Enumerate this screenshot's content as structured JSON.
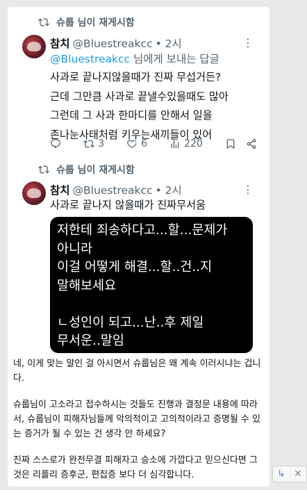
{
  "tweet1": {
    "retweet_text": "슈룹 님이 재게시함",
    "author_name": "참치",
    "author_handle": "@Bluestreakcc",
    "time": "• 2시",
    "reply_mention": "@Bluestreakcc",
    "reply_suffix": " 님에게 보내는 답글",
    "body": "사과로 끝나지않을때가 진짜 무섭거든?\n근데 그만큼 사과로 끝낼수있을때도 많아\n그런데 그 사과 한마디를 안해서 일을\n존나눈사태처럼 키우는새끼들이 있어",
    "retweets": "3",
    "likes": "6",
    "views": "220"
  },
  "tweet2": {
    "retweet_text": "슈룹 님이 재게시함",
    "author_name": "참치",
    "author_handle": "@Bluestreakcc",
    "time": "• 2시",
    "body": "사과로 끝나지 않을때가 진짜무서움",
    "image_text": "저한테 죄송하다고...할...문제가\n아니라\n이걸 어떻게 해결...할..건..지\n말해보세요\n\nㄴ성인이 되고...난..후 제일\n무서운..말임"
  },
  "comment": {
    "p1": "네, 이게 맞는 말인 걸 아시면서 슈룹님은 왜 계속 이러시냐는 겁니다.",
    "p2": "슈룹님이 고소라고 접수하시는 것들도 진행과 결정문 내용에 따라서, 슈룹님이 피해자님들께 악의적이고 고의적이라고 증명될 수 있는 증거가 될 수 있는 건 생각 안 하세요?",
    "p3": "진짜 스스로가 완전무결 피해자고 승소에 가깝다고 믿으신다면 그것은 리플리 증후군, 편집증 보다 더 심각합니다."
  },
  "icons": {
    "retweet": "retweet-icon",
    "reply": "reply-icon",
    "like": "heart-icon",
    "views": "views-icon",
    "bookmark": "bookmark-icon",
    "share": "share-icon",
    "more": "more-icon"
  }
}
